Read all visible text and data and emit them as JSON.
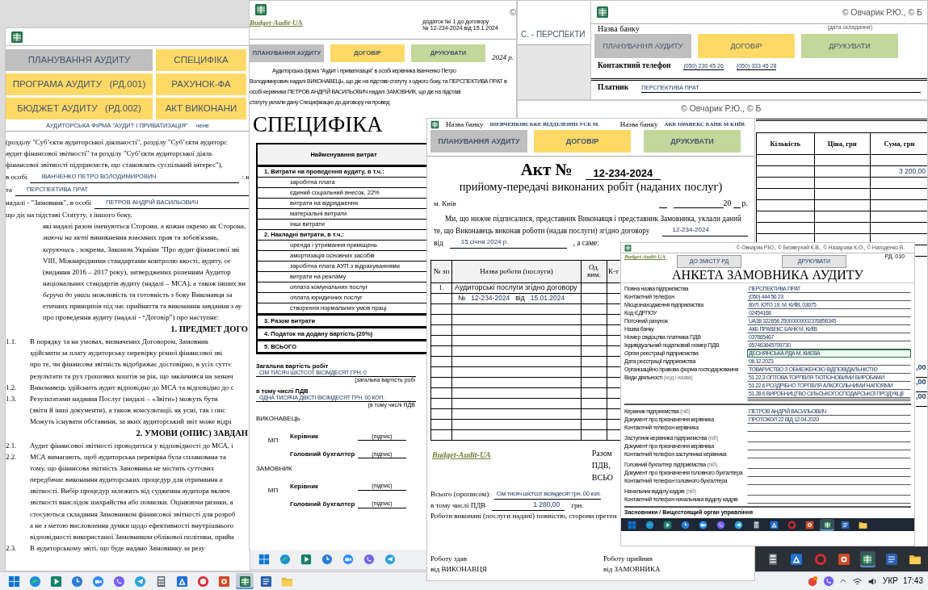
{
  "left_window": {
    "nav_buttons": [
      {
        "label": "ПЛАНУВАННЯ АУДИТУ",
        "color": "#bfbfbf"
      },
      {
        "label": "СПЕЦИФІКА",
        "color": "#ffd966"
      },
      {
        "label": "ПРОГРАМА АУДИТУ   (РД.001)",
        "color": "#ffd966"
      },
      {
        "label": "РАХУНОК-ФА",
        "color": "#ffd966"
      },
      {
        "label": "БЮДЖЕТ АУДИТУ   (РД.002)",
        "color": "#ffd966"
      },
      {
        "label": "АКТ ВИКОНАНИ",
        "color": "#ffd966"
      }
    ],
    "firm": "АУДИТОРСЬКА ФІРМА \"АУДИТ І ПРИВАТИЗАЦІЯ\"",
    "firm_tail": "чене",
    "intro_lines": [
      "(розділу \"Суб’єкти аудиторської діяльності\", розділу \"Суб’єкти аудиторс",
      "аудит фінансової звітності\" та розділу \"Суб’єкти аудиторської діяль",
      "фінансової звітності підприємств, що становлять суспільний інтерес\"),"
    ],
    "parties": [
      {
        "label": "в особі",
        "value": "ІВАНЧЕНКО ПЕТРО ВОЛОДИМИРОВИЧ",
        "tail": ": н"
      },
      {
        "label": "та",
        "value": "ПЕРСПЕКТИВА ПРАТ"
      },
      {
        "label": "надалі - \"Замовник\", в особі",
        "value": "ПЕТРОВ АНДРІЙ ВАСИЛЬОВИЧ"
      }
    ],
    "basis": "що діє на підставі Статуту, з іншого боку,",
    "preamble": [
      "які надалі разом іменуються Сторони, а кожна окремо як Сторона,",
      "*маючи на меті* виникнення взаємних прав та зобов'язань,",
      "*керуючись* , зокрема, Законом України \"Про аудит фінансової зві",
      "VIII, Міжнародними стандартами контролю якості, аудиту, ог",
      "(видання 2016 – 2017 року), затверджених рішенням Аудитор",
      "національних стандартів аудиту (надалі – МСА), а також інших ви",
      "*беручи до уваги* можливість та готовність з боку Виконавця за",
      "етичних принципів під час прийняття та виконання завдання з ау",
      "про проведення аудиту (надалі - “Договір”) про наступне:"
    ],
    "sections": [
      {
        "kind": "heading",
        "text": "1. ПРЕДМЕТ ДОГО"
      },
      {
        "kind": "clause",
        "number": "1.1.",
        "lines": [
          "В порядку та на умовах, визначених Договором, Замовник",
          "здійснити за плату аудиторську перевірку річної фінансової зві",
          "про те, чи фінансова звітність відображає достовірно, в усіх суттє",
          "результати та рух грошових коштів за рік, що закінчився на зазнач"
        ]
      },
      {
        "kind": "clause",
        "number": "1.2.",
        "lines": [
          "Виконавець здійснить аудит відповідно до МСА та відповідно до с"
        ]
      },
      {
        "kind": "clause",
        "number": "1.3.",
        "lines": [
          "Результатами надання Послуг (надалі – «Звіти») можуть бути",
          "(звіти й інші документи), а також консультації, як усні, так і пис",
          "Можуть існувати обставини, за яких аудиторський звіт може відрі"
        ]
      },
      {
        "kind": "heading",
        "text": "2. УМОВИ (ОПИС) ЗАВДАН"
      },
      {
        "kind": "clause",
        "number": "2.1.",
        "lines": [
          "Аудит фінансової звітності проводиться у відповідності до МСА, і"
        ]
      },
      {
        "kind": "clause",
        "number": "2.2.",
        "lines": [
          "МСА вимагають, щоб аудиторська перевірка була спланована та",
          "тому, що фінансова звітність Замовника не містить суттєвих",
          "передбачає виконання аудиторських процедур для отримання а",
          "звітності. Вибір процедур залежить від судження аудитора включ",
          "звітності внаслідок шахрайства або помилки. Оцінюючи ризики, а",
          "стосуються складання Замовником фінансової звітності для розроб",
          "а не з метою висловлення думки щодо ефективності внутрішнього",
          "відповідності використаної Замовником облікової політики, прийн"
        ]
      },
      {
        "kind": "clause",
        "number": "2.3.",
        "lines": [
          "В аудиторському звіті, що буде надано Замовнику за резу"
        ]
      }
    ]
  },
  "spec_window": {
    "logo": "Budget-Audit-UA",
    "annex_lines": [
      "додаток № 1 до договору",
      "№ 12-234-2024   від 15.1.2024"
    ],
    "copyright": "©",
    "buttons": [
      {
        "label": "ПЛАНУВАННЯ АУДИТУ",
        "color": "#bfbfbf"
      },
      {
        "label": "ДОГОВІР",
        "color": "#ffd966"
      },
      {
        "label": "ДРУКУВАТИ",
        "color": "#c4d79b"
      }
    ],
    "date_tail": "2024 р.",
    "intro_lines": [
      "Аудиторська фірма \"Аудит і приватизація\" в особі керівника Іванченко Петро",
      "Володимирович надалі ВИКОНАВЕЦЬ, що діє на підставі статуту з одного боку, та ПЕРСПЕКТИВА ПРАТ в",
      "особі керівника ПЕТРОВ АНДРІЙ ВАСИЛЬОВИЧ надалі ЗАМОВНИК, що діє на підставі",
      "статуту уклали дану Специфікацію до договору на провед"
    ],
    "title": "СПЕЦИФІКА",
    "table": {
      "header": "Найменування витрат",
      "rows": [
        {
          "kind": "group",
          "text": "1. Витрати на проведення аудиту, в т.ч.:"
        },
        {
          "kind": "item",
          "text": "заробітна плата"
        },
        {
          "kind": "item",
          "text": "єдиний соціальний внесок, 22%"
        },
        {
          "kind": "item",
          "text": "витрати на відрядження"
        },
        {
          "kind": "item",
          "text": "матеріальні витрати"
        },
        {
          "kind": "item",
          "text": "інші витрати"
        },
        {
          "kind": "group",
          "text": "2. Накладні витрати, в т.ч.:"
        },
        {
          "kind": "item",
          "text": "оренда і утримання приміщень"
        },
        {
          "kind": "item",
          "text": "амортизація основних засобів"
        },
        {
          "kind": "item",
          "text": "заробітна плата АУП з відрахуваннями"
        },
        {
          "kind": "item",
          "text": "витрати на рекламу"
        },
        {
          "kind": "item",
          "text": "оплата комунальних послуг"
        },
        {
          "kind": "item",
          "text": "оплата юридичних послуг"
        },
        {
          "kind": "item",
          "text": "створення нормальних умов праці"
        },
        {
          "kind": "total",
          "text": "3. Разом витрати"
        },
        {
          "kind": "total",
          "text": "4. Податок на додану вартість (20%)"
        },
        {
          "kind": "total",
          "text": "5. ВСЬОГО"
        }
      ]
    },
    "totals": [
      {
        "label": "Загальна вартість робіт",
        "value": "СІМ ТИСЯЧ ШІСТСОТ ВІСІМДЕСЯТ ГРН. 0",
        "caption": "(загальна вартість робі"
      },
      {
        "label": "в тому числі ПДВ",
        "value": "ОДНА ТИСЯЧА ДВІСТІ ВІСІМДЕСЯТ ГРН. 00 КОП.",
        "caption": "(в тому числі ПДВ"
      }
    ],
    "signatures": [
      {
        "party": "ВИКОНАВЕЦЬ",
        "stamp": "МП",
        "roles": [
          {
            "title": "Керівник",
            "sign": "(підпис)"
          },
          {
            "title": "Головний бухгалтер",
            "sign": "(підпис)"
          }
        ]
      },
      {
        "party": "ЗАМОВНИК",
        "stamp": "МП",
        "roles": [
          {
            "title": "Керівник",
            "sign": "(підпис)"
          },
          {
            "title": "Головний бухгалтер",
            "sign": "(підпис)"
          }
        ]
      }
    ]
  },
  "back_window": {
    "text": "С.  -  ПЕРСПЕКТИ"
  },
  "bank_window": {
    "copyright": "© Овчарик Р.Ю., © Б",
    "date_caption": "(дата складання)",
    "bank_label": "Назва банку",
    "buttons": [
      {
        "label": "ПЛАНУВАННЯ АУДИТУ",
        "color": "#bfbfbf"
      },
      {
        "label": "ДОГОВІР",
        "color": "#ffd966"
      },
      {
        "label": "ДРУКУВАТИ",
        "color": "#c4d79b"
      }
    ],
    "phone_label": "Контактний телефон",
    "phones": [
      "(050) 230 45 26",
      "(050) 333 45 28"
    ],
    "payer_label": "Платник",
    "payer": "ПЕРСПЕКТИВА ПРАТ"
  },
  "invoice_window": {
    "copyright": "© Овчарик Р.Ю., © Б",
    "columns": [
      "Кількість",
      "Ціна, грн",
      "Сума, грн"
    ],
    "rows": [
      {},
      {
        "sum": "3 200,00"
      },
      {},
      {},
      {},
      {},
      {},
      {},
      {}
    ],
    "tail_values": [
      ",00",
      ",00",
      ",00"
    ]
  },
  "act_window": {
    "bank_fields": [
      {
        "label": "Назва банку",
        "value": "ШЕВЧЕНКІВСЬКЕ ВІДДІЛЕННІ УСБ М."
      },
      {
        "label": "Назва банку",
        "value": "АКБ ПРАВЕКС БАНК М КИЇВ"
      }
    ],
    "buttons": [
      {
        "label": "ПЛАНУВАННЯ АУДИТУ",
        "color": "#bfbfbf"
      },
      {
        "label": "ДОГОВІР",
        "color": "#ffd966"
      },
      {
        "label": "ДРУКУВАТИ",
        "color": "#c4d79b"
      }
    ],
    "title": "Акт №",
    "number": "12-234-2024",
    "subtitle": "прийому-передачі виконаних робіт (наданих послуг)",
    "city": "м. Київ",
    "date_year": "20",
    "date_suffix": "р.",
    "intro": "Ми, що нижче підписалися, представник Виконавця і представник Замовника, уклали даний",
    "contract_line": {
      "text": "те, що Виконавець виконав роботи (надав послуги) згідно договору",
      "value": "12-234-2024"
    },
    "date_line": {
      "label": "від",
      "value": "15 січня 2024 р.",
      "tail": ", а саме:"
    },
    "table": {
      "columns": [
        "№ зп",
        "Назва роботи (послуги)",
        "Од. вим.",
        "К-т"
      ],
      "rows": [
        {
          "number": "1.",
          "name": "Аудиторські послуги згідно договору"
        },
        {
          "ref": [
            "№",
            "12-234-2024",
            "від",
            "15.01.2024"
          ]
        },
        {},
        {},
        {},
        {},
        {},
        {},
        {},
        {},
        {},
        {},
        {},
        {},
        {}
      ]
    },
    "logo": "Budget-Audit-UA",
    "total_labels": [
      "Разом",
      "ПДВ,",
      "ВСЬО"
    ],
    "in_words": {
      "label": "Всього (прописом):",
      "value": "Сім тисяч шістсот вісімдесят грн. 00 коп."
    },
    "vat": {
      "label": "в тому числі ПДВ",
      "value": "1 280,00",
      "unit": "грн."
    },
    "done_text": "Роботи виконані (послуги надані) повністю, сторони претен",
    "signoff": [
      {
        "title": "Роботу здав",
        "party": "від ВИКОНАВЦЯ"
      },
      {
        "title": "Роботу прийняв",
        "party": "від ЗАМОВНИКА"
      }
    ]
  },
  "anketa_window": {
    "copyright": "© Овчарик Р.Ю., © Безверхий К.В., © Назарова К.О., © Нагоденко В.",
    "logo": "Budget-Audit-UA",
    "buttons": [
      "ДО ЗМІСТУ РД",
      "ДРУКУВАТИ"
    ],
    "code": "РД. 010",
    "title": "АНКЕТА ЗАМОВНИКА АУДИТУ",
    "sections": [
      [
        {
          "label": "Повна назва підприємства",
          "values": [
            "ПЕРСПЕКТИВА ПРАТ"
          ],
          "selected": false
        },
        {
          "label": "Контактний телефон",
          "values": [
            "(050) 444 56 23"
          ],
          "selected": false
        },
        {
          "label": "Місцезнаходження підприємства",
          "values": [
            "ВУЛ. ЮТО 19, М. КИЇВ, 03675"
          ],
          "selected": false
        },
        {
          "label": "Код ЄДРПОУ",
          "values": [
            "02454168"
          ],
          "selected": false
        },
        {
          "label": "Поточний рахунок",
          "values": [
            "UA38 322656 25000000002376856345"
          ],
          "selected": false
        },
        {
          "label": "Назва банку",
          "values": [
            "АКБ ПРАВЕКС БАНК М. КИЇВ"
          ],
          "selected": false
        },
        {
          "label": "Номер свідоцтва платника ПДВ",
          "values": [
            "037865467"
          ],
          "selected": false
        },
        {
          "label": "Індивідуальний податковий номер ПДВ",
          "values": [
            "657463645709730"
          ],
          "selected": false
        },
        {
          "label": "Орган реєстрації підприємства",
          "values": [
            "ДЕСНЯНСЬКА РДА М. КИЄВА"
          ],
          "selected": true
        },
        {
          "label": "Дата реєстрації підприємства",
          "values": [
            "06.12.2023"
          ],
          "selected": false
        },
        {
          "label": "Організаційно правова форма господарювання",
          "values": [
            "ТОВАРИСТВО З ОБМЕЖЕНОЮ ВІДПОВІДАЛЬНІСТЮ"
          ],
          "selected": false
        },
        {
          "label": "Види діяльності",
          "note": "(код і назва)",
          "values": [
            "51.22.3 ОПТОВА ТОРГІВЛЯ ТЮТЮНОВИМИ ВИРОБАМИ",
            "51.22.6 РОЗДРІБНО ТОРГІВЛЯ АЛКОГОЛЬНИМИ НАПОЯМИ",
            "51.28.6 ВИРОБНИЦТВО СІЛЬСЬКОГОСПОДАРСЬКОЇ ПРОДУКЦІЇ"
          ],
          "selected": false
        }
      ],
      [
        {
          "label": "Керівник підприємства",
          "note": "(піб)",
          "values": [
            "ПЕТРОВ АНДРІЙ ВАСИЛЬОВИЧ"
          ],
          "selected": false
        },
        {
          "label": "Документ про призначення керівника",
          "values": [
            "ПРОТОКОЛ 22 ВІД 12.04.2020"
          ],
          "selected": false
        },
        {
          "label": "Контактний телефон керівника",
          "selected": false
        },
        {
          "label": "Заступник керівника підприємства",
          "note": "(піб)",
          "selected": false
        },
        {
          "label": "Документ про призначення керівника",
          "selected": false
        },
        {
          "label": "Контактний телефон заступника керівника",
          "selected": false
        },
        {
          "label": "Головний бухгалтер підприємства",
          "note": "(піб)",
          "selected": false
        },
        {
          "label": "Документ про призначення головного бухгалтера",
          "selected": false
        },
        {
          "label": "Контактний телефон головного бухгалтера",
          "selected": false
        },
        {
          "label": "Начальник відділу кадрів",
          "note": "(піб)",
          "selected": false
        },
        {
          "label": "Контактний телефон начальника відділу кадрів",
          "selected": false
        }
      ]
    ],
    "footer": "Засновники / Вищестоящий орган управління",
    "taskbar": {
      "apps": [
        {
          "kind": "start",
          "selected": false
        },
        {
          "kind": "swirl",
          "selected": false
        },
        {
          "kind": "play",
          "selected": false
        },
        {
          "kind": "clock",
          "selected": false
        },
        {
          "kind": "camera",
          "selected": false
        },
        {
          "kind": "phone",
          "selected": false
        },
        {
          "kind": "plane",
          "selected": false
        },
        {
          "kind": "calculator",
          "selected": false
        },
        {
          "kind": "triangle",
          "selected": false
        },
        {
          "kind": "ring",
          "selected": false
        },
        {
          "kind": "slides",
          "selected": false
        },
        {
          "kind": "sheet",
          "selected": true
        },
        {
          "kind": "doc",
          "selected": false
        },
        {
          "kind": "folder",
          "selected": false
        }
      ]
    }
  },
  "taskbar_strips": [
    {
      "apps": [
        {
          "kind": "start",
          "selected": false
        },
        {
          "kind": "swirl",
          "selected": false
        },
        {
          "kind": "play",
          "selected": false
        },
        {
          "kind": "clock",
          "selected": false
        },
        {
          "kind": "camera",
          "selected": false
        },
        {
          "kind": "phone",
          "selected": false
        },
        {
          "kind": "plane",
          "selected": false
        }
      ]
    },
    {
      "apps": [
        {
          "kind": "calculator",
          "selected": false
        },
        {
          "kind": "triangle",
          "selected": false
        },
        {
          "kind": "ring",
          "selected": false
        },
        {
          "kind": "slides",
          "selected": false
        },
        {
          "kind": "sheet",
          "selected": true
        },
        {
          "kind": "doc",
          "selected": false
        },
        {
          "kind": "folder",
          "selected": false
        }
      ]
    }
  ],
  "taskbar": {
    "apps": [
      {
        "kind": "start",
        "selected": false
      },
      {
        "kind": "swirl",
        "selected": false
      },
      {
        "kind": "play",
        "selected": false
      },
      {
        "kind": "clock",
        "selected": false
      },
      {
        "kind": "camera",
        "selected": false
      },
      {
        "kind": "phone",
        "selected": false
      },
      {
        "kind": "plane",
        "selected": false
      },
      {
        "kind": "calculator",
        "selected": false
      },
      {
        "kind": "triangle",
        "selected": false
      },
      {
        "kind": "ring",
        "selected": false
      },
      {
        "kind": "slides",
        "selected": false
      },
      {
        "kind": "sheet",
        "selected": true
      },
      {
        "kind": "doc",
        "selected": false
      },
      {
        "kind": "folder",
        "selected": false
      }
    ],
    "language": "УКР",
    "time": "17:43"
  }
}
